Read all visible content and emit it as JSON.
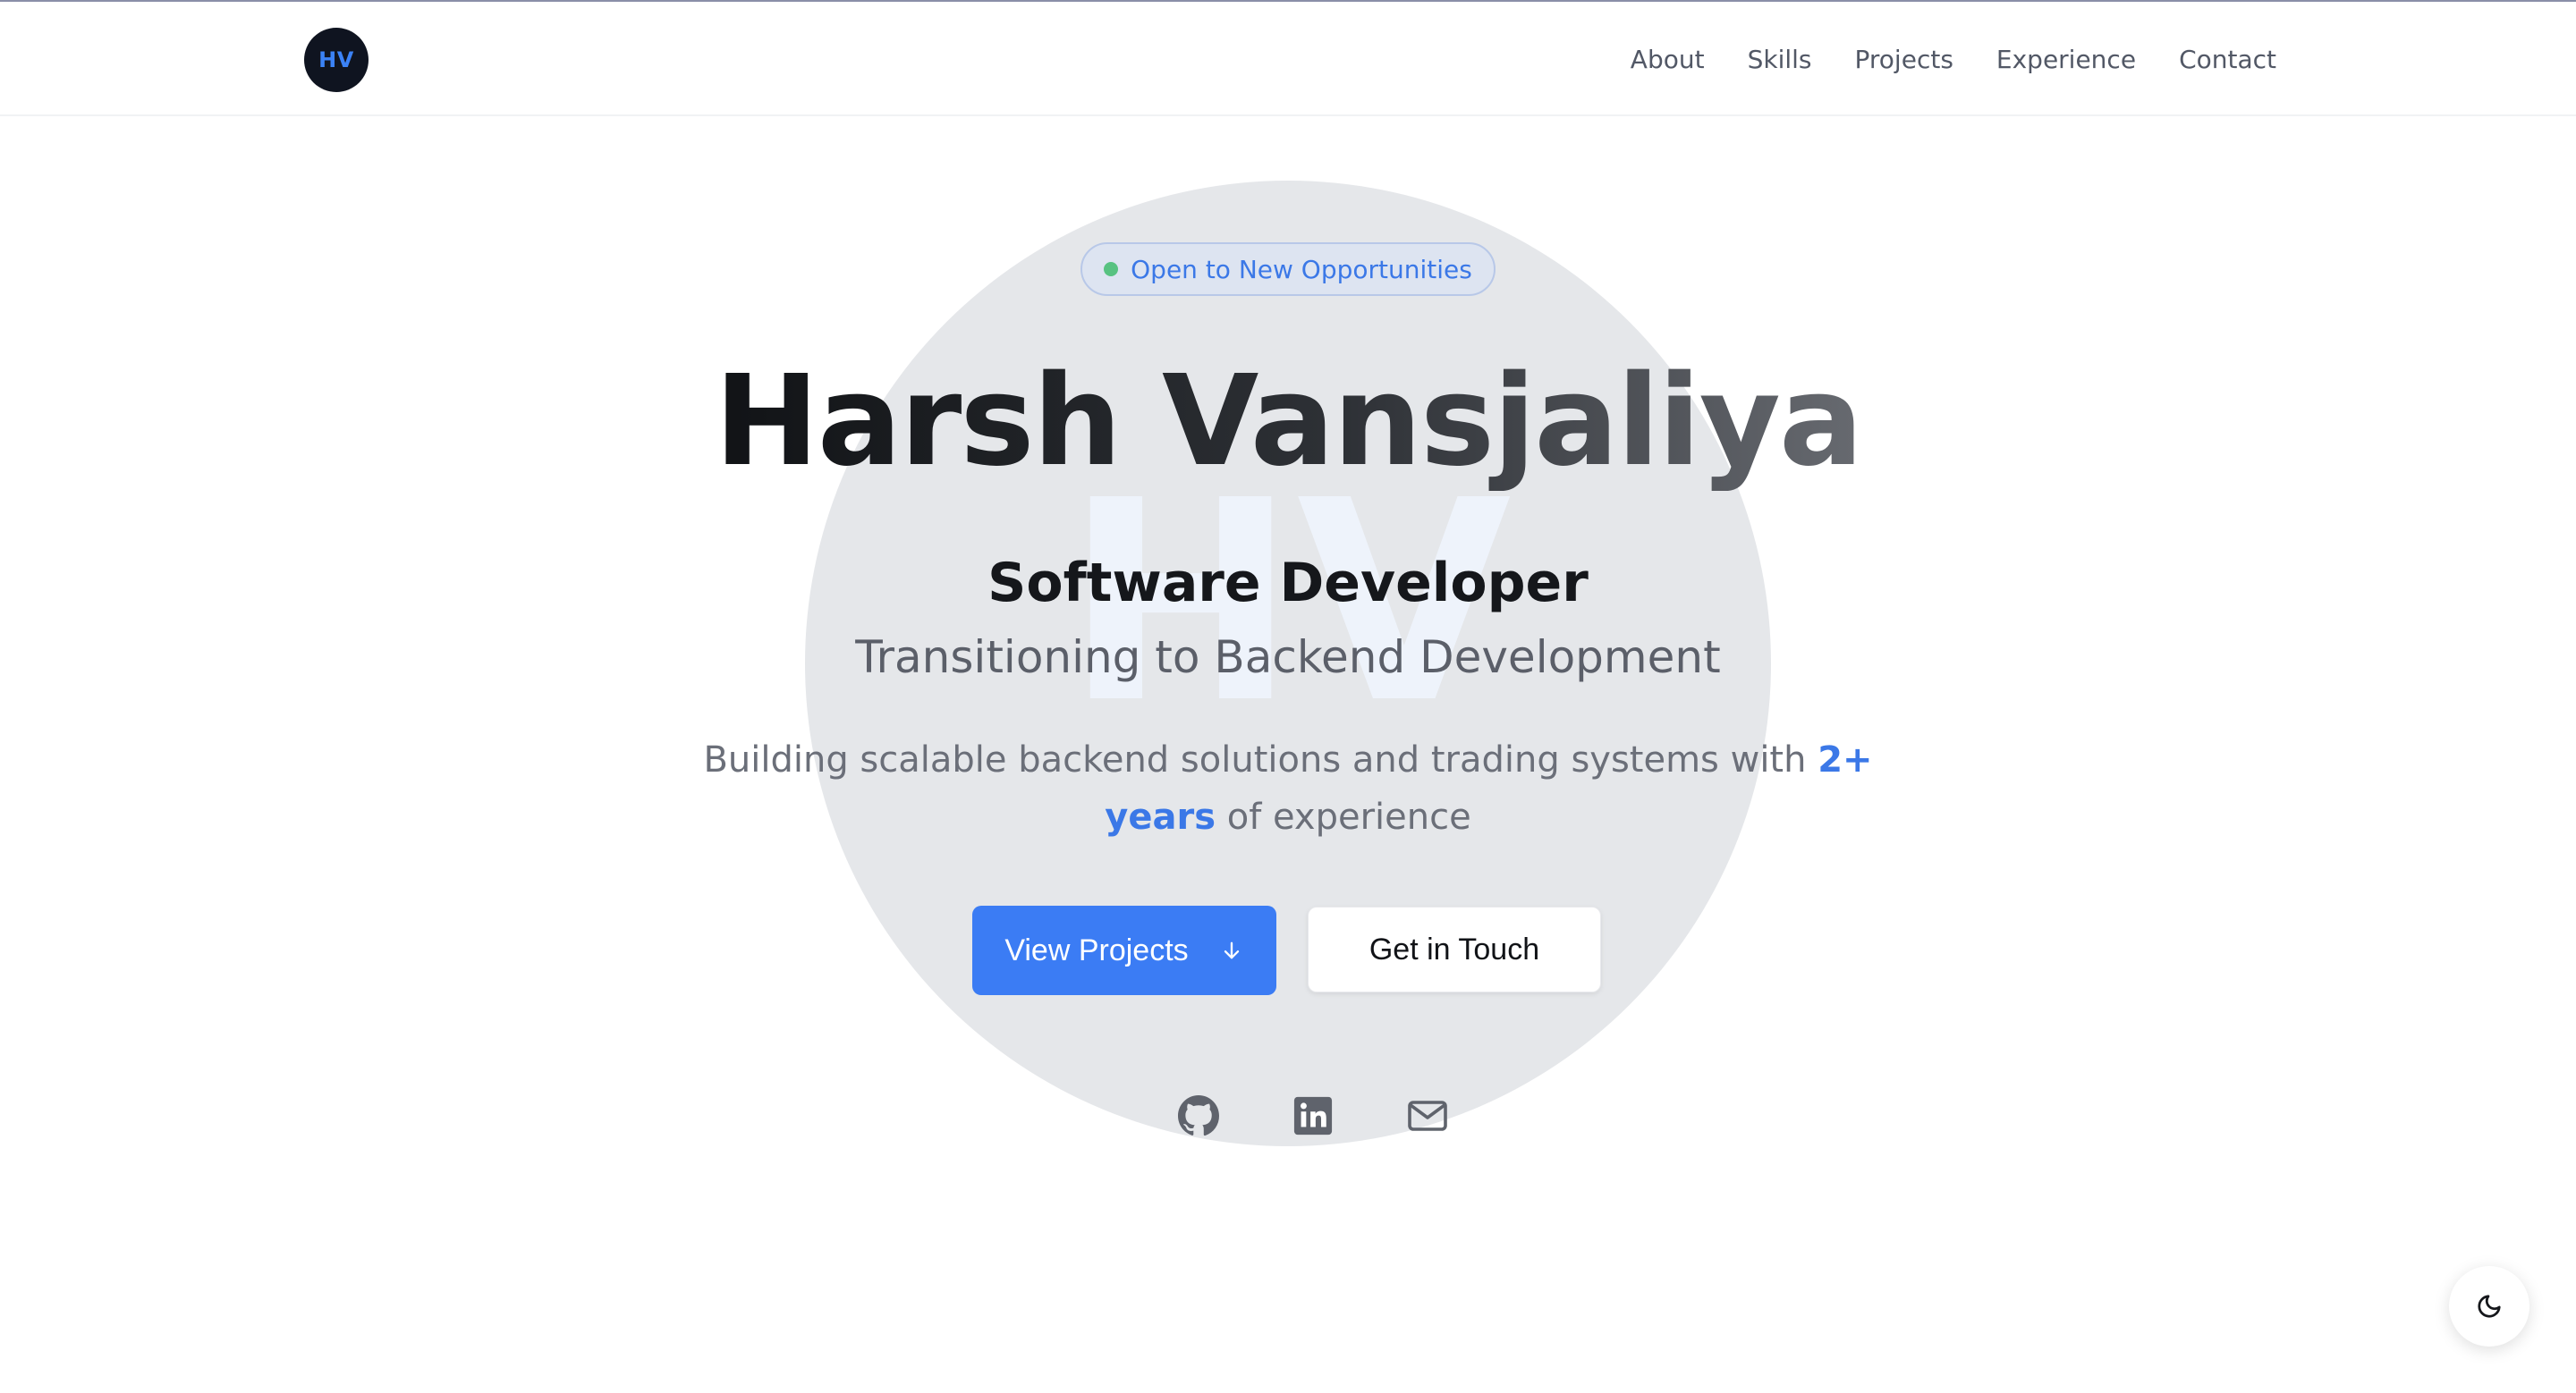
{
  "nav": {
    "logo_text": "HV",
    "links": [
      "About",
      "Skills",
      "Projects",
      "Experience",
      "Contact"
    ]
  },
  "hero": {
    "watermark": "HV",
    "badge": "Open to New Opportunities",
    "name": "Harsh Vansjaliya",
    "role": "Software Developer",
    "subrole": "Transitioning to Backend Development",
    "desc_prefix": "Building scalable backend solutions and trading systems with ",
    "desc_highlight": "2+ years",
    "desc_suffix": " of experience",
    "primary_button": "View Projects",
    "secondary_button": "Get in Touch"
  },
  "socials": {
    "icons": [
      "github-icon",
      "linkedin-icon",
      "mail-icon"
    ]
  },
  "theme_toggle": {
    "icon": "moon-icon"
  },
  "colors": {
    "accent": "#3b7cf4",
    "badge_dot": "#57c281",
    "hero_circle": "#e5e7ea"
  }
}
